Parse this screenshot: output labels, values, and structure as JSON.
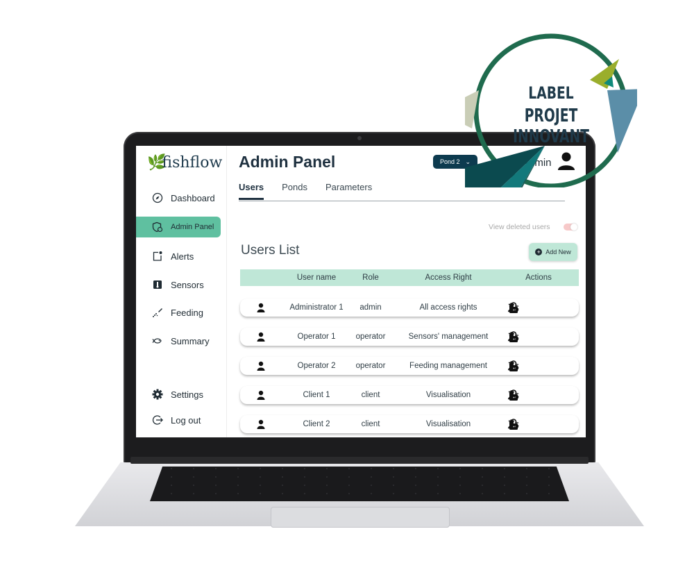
{
  "app": {
    "logo_text": "fishflow",
    "page_title": "Admin Panel",
    "pond_select": "Pond 2",
    "user_label": "Admin"
  },
  "sidebar": {
    "items": [
      {
        "label": "Dashboard",
        "icon": "compass-icon"
      },
      {
        "label": "Admin Panel",
        "icon": "shield-user-icon",
        "active": true
      },
      {
        "label": "Alerts",
        "icon": "alert-note-icon"
      },
      {
        "label": "Sensors",
        "icon": "sensor-icon"
      },
      {
        "label": "Feeding",
        "icon": "feeding-icon"
      },
      {
        "label": "Summary",
        "icon": "fish-icon"
      }
    ],
    "settings_label": "Settings",
    "logout_label": "Log out"
  },
  "tabs": [
    {
      "label": "Users",
      "active": true
    },
    {
      "label": "Ponds"
    },
    {
      "label": "Parameters"
    }
  ],
  "view_deleted_label": "View deleted users",
  "view_deleted_on": false,
  "users_list": {
    "title": "Users List",
    "add_new_label": "Add New",
    "columns": [
      "User name",
      "Role",
      "Access Right",
      "Actions"
    ],
    "rows": [
      {
        "name": "Administrator 1",
        "role": "admin",
        "access": "All access rights"
      },
      {
        "name": "Operator 1",
        "role": "operator",
        "access": "Sensors' management"
      },
      {
        "name": "Operator 2",
        "role": "operator",
        "access": "Feeding management"
      },
      {
        "name": "Client 1",
        "role": "client",
        "access": "Visualisation"
      },
      {
        "name": "Client 2",
        "role": "client",
        "access": "Visualisation"
      }
    ]
  },
  "badge": {
    "line1": "LABEL",
    "line2": "PROJET INNOVANT"
  },
  "colors": {
    "accent": "#5fc0a0",
    "header_bg": "#bfe7d7",
    "dark": "#0d3b4f",
    "badge_ring": "#1f6b4e"
  }
}
